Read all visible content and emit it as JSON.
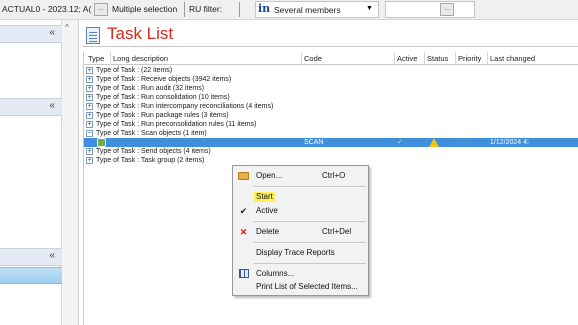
{
  "topbar": {
    "scope_text": "ACTUAL0 - 2023.12; A(",
    "scope_btn": "...",
    "multiple_selection": "Multiple selection",
    "ru_filter_label": "RU filter:",
    "in_icon": "in",
    "ru_filter_value": "Several members",
    "right_btn": "..."
  },
  "leftnav": {
    "sections": [
      "collapse-chevron",
      "collapse-chevron",
      "collapse-chevron"
    ]
  },
  "task_list": {
    "title": "Task List",
    "columns": {
      "type": "Type",
      "long_description": "Long description",
      "code": "Code",
      "active": "Active",
      "status": "Status",
      "priority": "Priority",
      "last_changed": "Last changed"
    },
    "rows": [
      {
        "expander": "+",
        "text": "Type of Task :  (22 items)"
      },
      {
        "expander": "+",
        "text": "Type of Task : Receive objects (3942 items)"
      },
      {
        "expander": "+",
        "text": "Type of Task : Run audit (32 items)"
      },
      {
        "expander": "+",
        "text": "Type of Task : Run consolidation (10 items)"
      },
      {
        "expander": "+",
        "text": "Type of Task : Run intercompany reconciliations (4 items)"
      },
      {
        "expander": "+",
        "text": "Type of Task : Run package rules (3 items)"
      },
      {
        "expander": "+",
        "text": "Type of Task : Run preconsolidation rules (11 items)"
      },
      {
        "expander": "−",
        "text": "Type of Task : Scan objects (1 item)"
      },
      {
        "expander": "+",
        "text": "Type of Task : Send objects (4 items)"
      },
      {
        "expander": "+",
        "text": "Type of Task : Task group (2 items)"
      }
    ],
    "selected_row": {
      "code": "SCAN",
      "active": "✓",
      "status_icon": "warning-icon",
      "priority": "→",
      "last_changed": "1/12/2024 4:"
    }
  },
  "context_menu": {
    "open": {
      "label": "Open...",
      "shortcut": "Ctrl+O"
    },
    "start": {
      "label": "Start"
    },
    "active": {
      "label": "Active",
      "checked": true
    },
    "delete": {
      "label": "Delete",
      "shortcut": "Ctrl+Del"
    },
    "display_trace": {
      "label": "Display Trace Reports"
    },
    "columns": {
      "label": "Columns..."
    },
    "print_list": {
      "label": "Print List of Selected Items..."
    },
    "highlight_color": "#fff15a"
  },
  "colors": {
    "title_red": "#d42a1e",
    "selection_blue": "#3e8fde",
    "nav_selected": "#9fcfee"
  }
}
